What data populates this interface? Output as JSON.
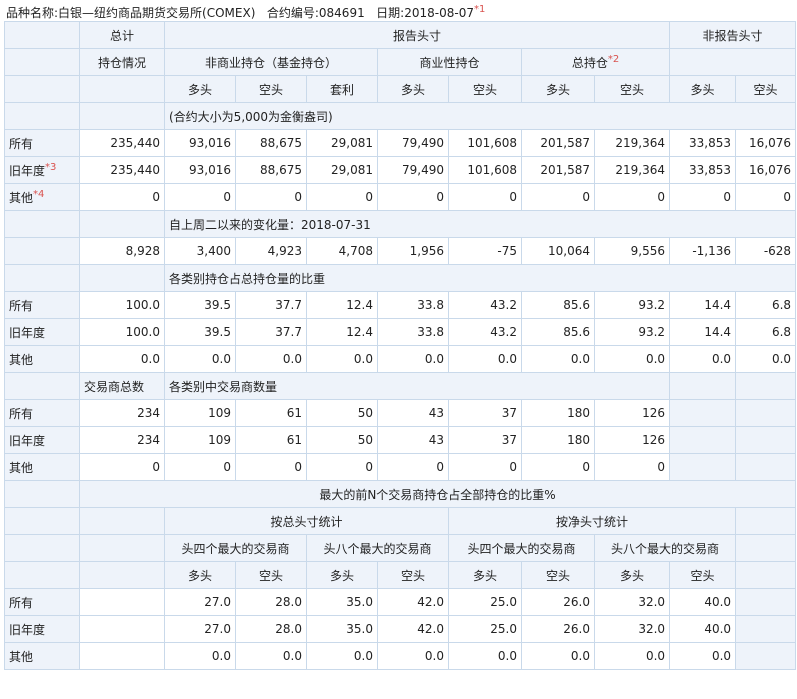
{
  "header": {
    "variety_label": "品种名称:",
    "variety": "白银—纽约商品期货交易所(COMEX)",
    "contract_label": "合约编号:",
    "contract": "084691",
    "date_label": "日期:",
    "date": "2018-08-07",
    "note1": "*1"
  },
  "cols": {
    "total": "总计",
    "reported": "报告头寸",
    "nonreported": "非报告头寸",
    "positions": "持仓情况",
    "noncommercial": "非商业持仓（基金持仓）",
    "commercial": "商业性持仓",
    "total_pos": "总持仓",
    "note2": "*2",
    "long": "多头",
    "short": "空头",
    "spread": "套利"
  },
  "row_labels": {
    "all": "所有",
    "old": "旧年度",
    "other": "其他",
    "note3": "*3",
    "note4": "*4"
  },
  "section1": {
    "title": "(合约大小为5,000为金衡盎司)",
    "rows": [
      [
        "235,440",
        "93,016",
        "88,675",
        "29,081",
        "79,490",
        "101,608",
        "201,587",
        "219,364",
        "33,853",
        "16,076"
      ],
      [
        "235,440",
        "93,016",
        "88,675",
        "29,081",
        "79,490",
        "101,608",
        "201,587",
        "219,364",
        "33,853",
        "16,076"
      ],
      [
        "0",
        "0",
        "0",
        "0",
        "0",
        "0",
        "0",
        "0",
        "0",
        "0"
      ]
    ]
  },
  "section2": {
    "title": "自上周二以来的变化量：2018-07-31",
    "row": [
      "8,928",
      "3,400",
      "4,923",
      "4,708",
      "1,956",
      "-75",
      "10,064",
      "9,556",
      "-1,136",
      "-628"
    ]
  },
  "section3": {
    "title": "各类别持仓占总持仓量的比重",
    "rows": [
      [
        "100.0",
        "39.5",
        "37.7",
        "12.4",
        "33.8",
        "43.2",
        "85.6",
        "93.2",
        "14.4",
        "6.8"
      ],
      [
        "100.0",
        "39.5",
        "37.7",
        "12.4",
        "33.8",
        "43.2",
        "85.6",
        "93.2",
        "14.4",
        "6.8"
      ],
      [
        "0.0",
        "0.0",
        "0.0",
        "0.0",
        "0.0",
        "0.0",
        "0.0",
        "0.0",
        "0.0",
        "0.0"
      ]
    ]
  },
  "section4": {
    "total_label": "交易商总数",
    "title": "各类别中交易商数量",
    "rows": [
      [
        "234",
        "109",
        "61",
        "50",
        "43",
        "37",
        "180",
        "126"
      ],
      [
        "234",
        "109",
        "61",
        "50",
        "43",
        "37",
        "180",
        "126"
      ],
      [
        "0",
        "0",
        "0",
        "0",
        "0",
        "0",
        "0",
        "0"
      ]
    ]
  },
  "section5": {
    "title": "最大的前N个交易商持仓占全部持仓的比重%",
    "gross": "按总头寸统计",
    "net": "按净头寸统计",
    "top4": "头四个最大的交易商",
    "top8": "头八个最大的交易商",
    "rows": [
      [
        "27.0",
        "28.0",
        "35.0",
        "42.0",
        "25.0",
        "26.0",
        "32.0",
        "40.0"
      ],
      [
        "27.0",
        "28.0",
        "35.0",
        "42.0",
        "25.0",
        "26.0",
        "32.0",
        "40.0"
      ],
      [
        "0.0",
        "0.0",
        "0.0",
        "0.0",
        "0.0",
        "0.0",
        "0.0",
        "0.0"
      ]
    ]
  }
}
